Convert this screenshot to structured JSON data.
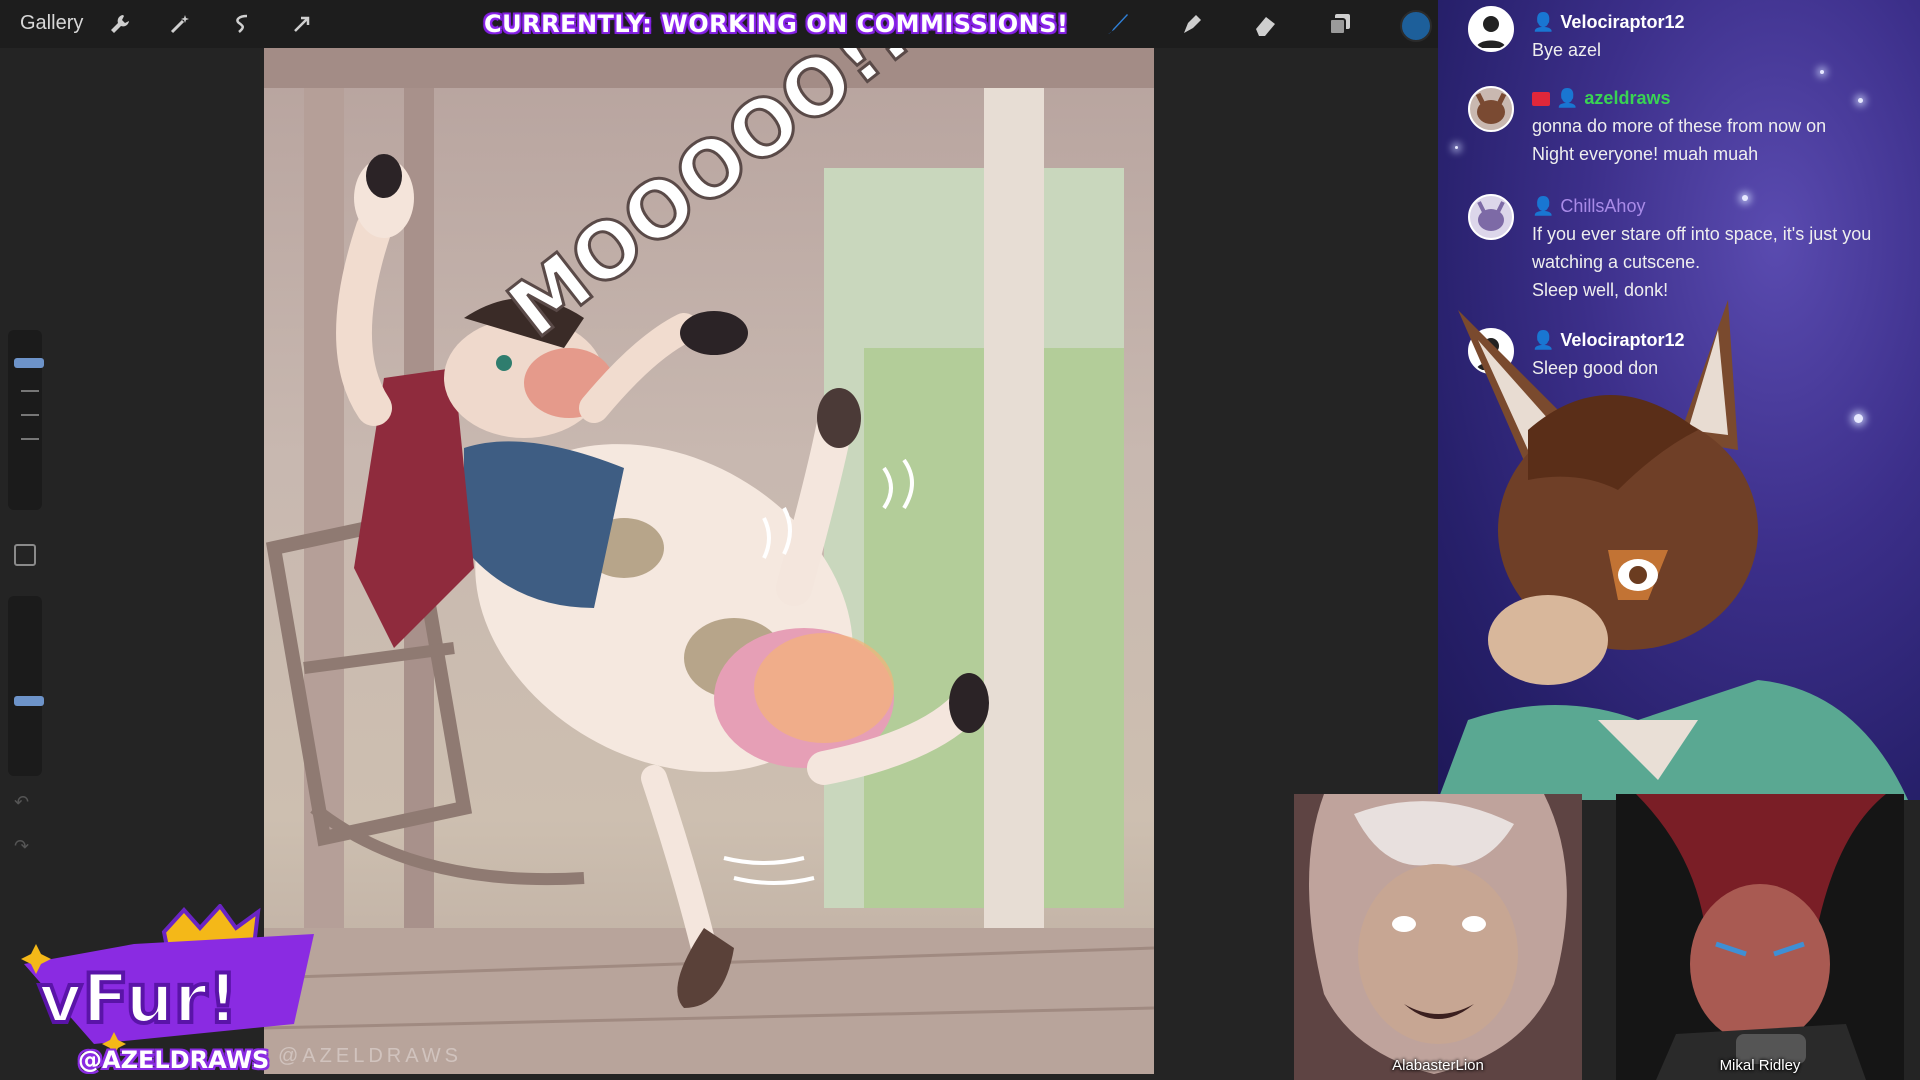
{
  "toolbar": {
    "gallery_label": "Gallery",
    "tools_left": [
      "wrench-icon",
      "magic-wand-icon",
      "selection-icon",
      "transform-arrow-icon"
    ],
    "tools_right": [
      "brush-icon",
      "smudge-icon",
      "eraser-icon",
      "layers-icon"
    ],
    "active_color": "#1d5f9a"
  },
  "banner": {
    "text": "CURRENTLY: WORKING ON COMMISSIONS!"
  },
  "canvas": {
    "watermark": "@AZELDRAWS",
    "sfx_text": "MOOOOO!!!"
  },
  "chat": {
    "messages": [
      {
        "user": "Velociraptor12",
        "text": [
          "Bye azel"
        ],
        "color": "#ffffff",
        "badges": [
          "person-icon"
        ]
      },
      {
        "user": "azeldraws",
        "text": [
          "gonna do more of these from now on",
          "Night everyone! muah muah"
        ],
        "color": "#39d353",
        "badges": [
          "broadcaster-badge",
          "person-icon"
        ]
      },
      {
        "user": "ChillsAhoy",
        "text": [
          "If you ever stare off into space, it's just you",
          "watching a cutscene.",
          "Sleep well, donk!"
        ],
        "color": "#a98be8",
        "badges": [
          "person-icon"
        ]
      },
      {
        "user": "Velociraptor12",
        "text": [
          "Sleep good don"
        ],
        "color": "#ffffff",
        "badges": [
          "person-icon"
        ]
      }
    ]
  },
  "webcams": [
    {
      "name": "AlabasterLion"
    },
    {
      "name": "Mikal Ridley"
    }
  ],
  "branding": {
    "logo_text": "vFur!",
    "handle": "@AZELDRAWS"
  }
}
